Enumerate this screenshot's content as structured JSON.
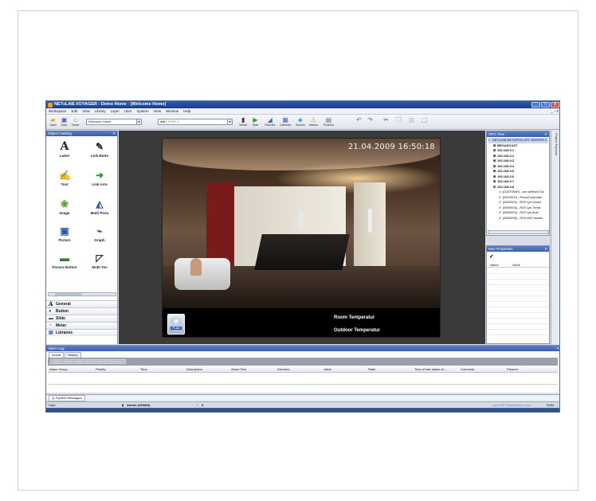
{
  "window": {
    "title": "NETxLAB.VOYAGER - Demo Home - [Welcome Home]",
    "controls": [
      "_",
      "□",
      "x"
    ]
  },
  "menu": {
    "items": [
      "Workspace",
      "Edit",
      "View",
      "Library",
      "Layer",
      "User",
      "System",
      "View",
      "Window",
      "Help"
    ],
    "mdi_controls": "_ ▫ x"
  },
  "toolbar": {
    "buttons": [
      {
        "label": "Open",
        "icon": "open-folder-icon"
      },
      {
        "label": "Save",
        "icon": "save-disk-icon"
      },
      {
        "label": "Home",
        "icon": "home-icon"
      },
      {
        "label": "Server",
        "icon": "server-icon"
      },
      {
        "label": "Start",
        "icon": "play-icon"
      },
      {
        "label": "Override",
        "icon": "override-icon"
      },
      {
        "label": "Calendar",
        "icon": "calendar-icon"
      },
      {
        "label": "Scenes",
        "icon": "scenes-icon"
      },
      {
        "label": "Alarms",
        "icon": "alarm-warning-icon"
      },
      {
        "label": "Protocol",
        "icon": "protocol-icon"
      }
    ],
    "page_combo": "Welcome Home",
    "layer_combo": "LAYER 1"
  },
  "object_catalog": {
    "title": "Object Catalog",
    "objects": [
      {
        "label": "Label",
        "icon": "label-a-icon"
      },
      {
        "label": "Link Butto",
        "icon": "link-button-icon"
      },
      {
        "label": "Text",
        "icon": "text-edit-icon"
      },
      {
        "label": "Link Arre",
        "icon": "link-arrow-icon"
      },
      {
        "label": "Image",
        "icon": "image-icon"
      },
      {
        "label": "Multi Pictu",
        "icon": "multi-picture-icon"
      },
      {
        "label": "Picture",
        "icon": "picture-icon"
      },
      {
        "label": "Graph",
        "icon": "graph-icon"
      },
      {
        "label": "Picture Button",
        "icon": "picture-button-icon"
      },
      {
        "label": "Multi Tex",
        "icon": "multi-text-icon"
      }
    ],
    "categories": [
      "General",
      "Button",
      "Slide",
      "Meter",
      "Libraries"
    ]
  },
  "canvas": {
    "datetime": "21.04.2009 16:50:18",
    "room_temp_label": "Room Temperatur",
    "outdoor_temp_label": "Outdoor Temperatur",
    "plan_button": "PLAN"
  },
  "opc_tree": {
    "title": "OPC Tree",
    "root": "NETxLAB.NETUPEN.OPC.SERVER.3",
    "nodes": [
      "BROADCAST",
      "192.168.0.1",
      "192.168.0.2",
      "192.168.0.3",
      "192.168.0.4",
      "192.168.0.5",
      "192.168.0.6",
      "192.168.0.7",
      "192.168.0.8"
    ],
    "leaves": [
      "[GATEWAY] - pre defined Ga",
      "[05/2/002] - RoomController",
      "[06/5/001] - R29 Lys Dimmi",
      "[06/5/003] - R29 Lys Trend",
      "[06/5/004] - R29 Lys Auto",
      "[06/5/005] - R29 VAV Heatin"
    ]
  },
  "item_properties": {
    "title": "Item Properties",
    "col_name": "Name",
    "col_value": "Value"
  },
  "right_strip": {
    "label": "Project Explorer"
  },
  "alarm_log": {
    "title": "Alarm Log",
    "tabs": [
      "Actual",
      "History"
    ],
    "group_hint": "Drag a column header here to group by that column",
    "columns": [
      "Alarm Group",
      "Priority",
      "Time",
      "Description",
      "Alarm Text",
      "Direction",
      "Value",
      "State",
      "Time of last status ch...",
      "Comment",
      "Present"
    ]
  },
  "system_messages": {
    "tab": "System Messages"
  },
  "statusbar": {
    "left": "Data",
    "user": "Admin (ADMIN)",
    "count": "0",
    "url": "www.NETxAutomation.com",
    "mode": "NUM"
  },
  "colors": {
    "title_bar": "#2d5cb8",
    "panel_header": "#4a6dbc",
    "canvas_bg": "#3a3a3a"
  }
}
